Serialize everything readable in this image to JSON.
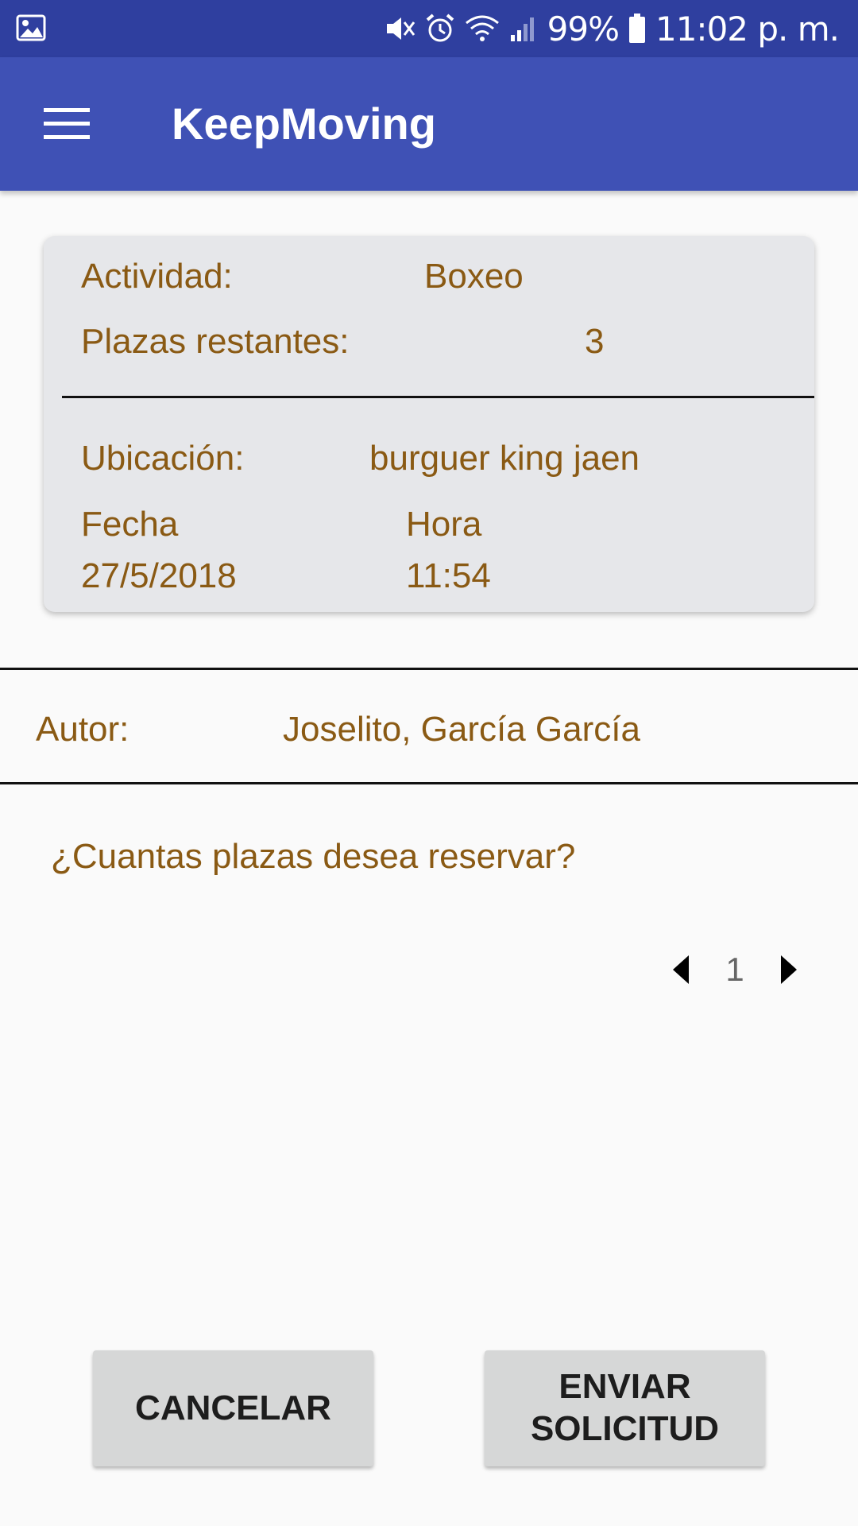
{
  "status_bar": {
    "battery": "99%",
    "time": "11:02 p. m.",
    "icons": [
      "image-icon",
      "mute-icon",
      "alarm-icon",
      "wifi-icon",
      "signal-icon",
      "battery-icon"
    ]
  },
  "app_bar": {
    "title": "KeepMoving",
    "menu_icon": "hamburger-menu-icon"
  },
  "card": {
    "activity_label": "Actividad:",
    "activity_value": "Boxeo",
    "seats_label": "Plazas restantes:",
    "seats_value": "3",
    "location_label": "Ubicación:",
    "location_value": "burguer king jaen",
    "date_label": "Fecha",
    "date_value": "27/5/2018",
    "time_label": "Hora",
    "time_value": "11:54"
  },
  "author": {
    "label": "Autor:",
    "value": "Joselito, García García"
  },
  "question": "¿Cuantas plazas desea reservar?",
  "stepper": {
    "value": "1",
    "decrement_icon": "triangle-left-icon",
    "increment_icon": "triangle-right-icon"
  },
  "buttons": {
    "cancel": "CANCELAR",
    "submit": "ENVIAR\nSOLICITUD"
  },
  "colors": {
    "status_bar": "#2f3f9f",
    "app_bar": "#3f51b5",
    "text_accent": "#8a5a14",
    "card_bg": "#e6e7ea",
    "button_bg": "#d6d7d7"
  }
}
